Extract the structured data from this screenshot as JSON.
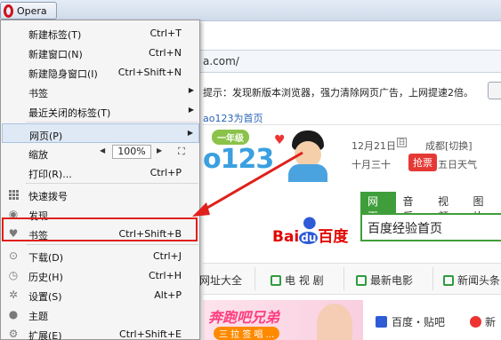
{
  "titlebar": {
    "opera_label": "Opera"
  },
  "address": {
    "url": "a.com/"
  },
  "notice": {
    "text": "提示：发现新版本浏览器，强力清除网页广告，上网提速2倍。"
  },
  "sethome": {
    "text": "ao123为首页"
  },
  "hao": {
    "badge": "一年级",
    "logo": "o123"
  },
  "info": {
    "date": "12月21日",
    "date_icon": "日",
    "city": "成都[切换]",
    "lunar": "十月三十",
    "lottery": "抢票",
    "weather": "五日天气"
  },
  "search": {
    "tabs": [
      {
        "label": "网页",
        "active": true
      },
      {
        "label": "音乐",
        "active": false
      },
      {
        "label": "视频",
        "active": false
      },
      {
        "label": "图片",
        "active": false
      }
    ],
    "baidu_text_a": "Bai",
    "baidu_du": "du",
    "baidu_cn": "百度",
    "query": "百度经验首页"
  },
  "navbar": {
    "items": [
      {
        "label": "网址大全"
      },
      {
        "label": "电 视 剧"
      },
      {
        "label": "最新电影"
      },
      {
        "label": "新闻头条"
      }
    ]
  },
  "banner": {
    "title": "奔跑吧兄弟",
    "sub": "三 拉 签 唱 ..."
  },
  "links": {
    "tieba": "百度・贴吧",
    "weibo": "新"
  },
  "menu": {
    "items": [
      {
        "label": "新建标签(T)",
        "shortcut": "Ctrl+T",
        "icon": ""
      },
      {
        "label": "新建窗口(N)",
        "shortcut": "Ctrl+N",
        "icon": ""
      },
      {
        "label": "新建隐身窗口(I)",
        "shortcut": "Ctrl+Shift+N",
        "icon": ""
      },
      {
        "label": "书签",
        "shortcut": "",
        "icon": "",
        "submenu": true
      },
      {
        "label": "最近关闭的标签(T)",
        "shortcut": "",
        "icon": "",
        "submenu": true
      },
      {
        "label": "网页(P)",
        "shortcut": "",
        "icon": "",
        "submenu": true,
        "highlighted": true
      },
      {
        "label": "缩放",
        "shortcut": "",
        "icon": "",
        "zoom": "100%"
      },
      {
        "label": "打印(R)...",
        "shortcut": "Ctrl+P",
        "icon": ""
      },
      {
        "label": "快速拨号",
        "shortcut": "",
        "icon": "speed-dial-icon"
      },
      {
        "label": "发现",
        "shortcut": "",
        "icon": "eye-icon"
      },
      {
        "label": "书签",
        "shortcut": "Ctrl+Shift+B",
        "icon": "heart-icon"
      },
      {
        "label": "下载(D)",
        "shortcut": "Ctrl+J",
        "icon": "download-icon"
      },
      {
        "label": "历史(H)",
        "shortcut": "Ctrl+H",
        "icon": "history-icon"
      },
      {
        "label": "设置(S)",
        "shortcut": "Alt+P",
        "icon": "gear-icon"
      },
      {
        "label": "主题",
        "shortcut": "",
        "icon": "drop-icon"
      },
      {
        "label": "扩展(E)",
        "shortcut": "Ctrl+Shift+E",
        "icon": "puzzle-icon"
      }
    ],
    "zoom_minus": "◀",
    "zoom_plus": "▶",
    "zoom_full": "⛶"
  },
  "colors": {
    "highlight": "#e0201b",
    "accent_green": "#3f9e3a",
    "baidu_blue": "#2f5bd7"
  }
}
